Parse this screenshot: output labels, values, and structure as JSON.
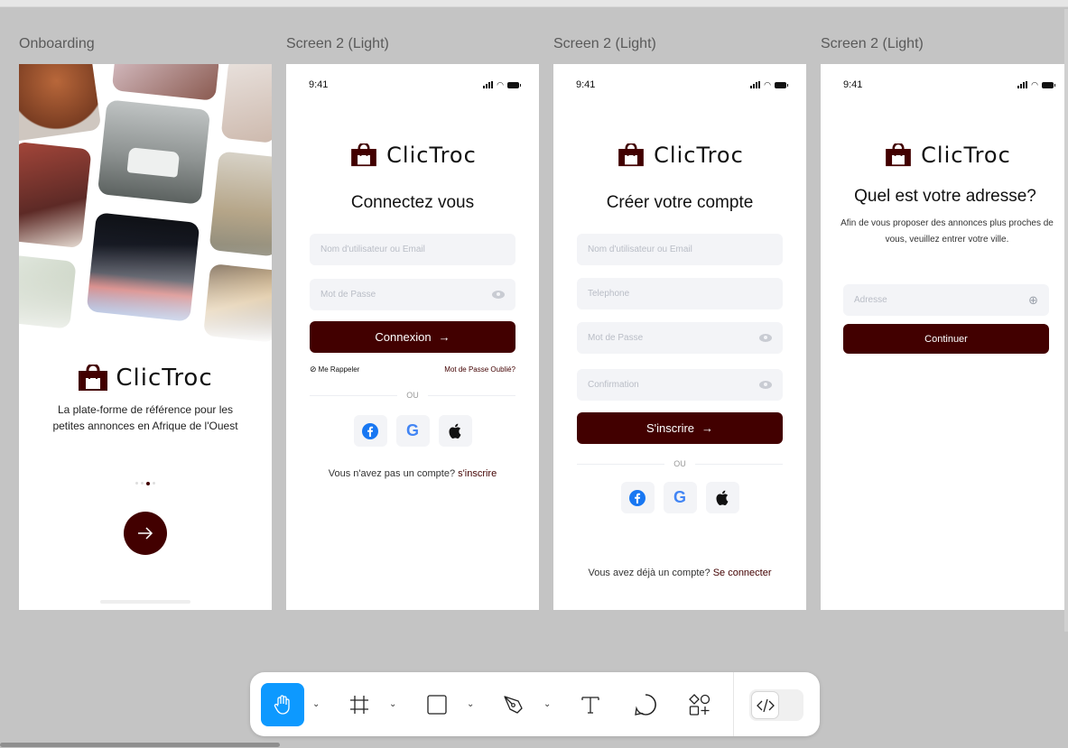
{
  "canvas": {
    "frames": [
      {
        "label": "Onboarding"
      },
      {
        "label": "Screen 2 (Light)"
      },
      {
        "label": "Screen 2 (Light)"
      },
      {
        "label": "Screen 2 (Light)"
      }
    ]
  },
  "status_time": "9:41",
  "brand_name": "ClicTroc",
  "onboarding": {
    "tagline": "La plate-forme de référence pour les petites annonces en Afrique de l'Ouest",
    "next_icon": "arrow-right-icon"
  },
  "login": {
    "title": "Connectez vous",
    "username_placeholder": "Nom d'utilisateur ou Email",
    "password_placeholder": "Mot de Passe",
    "submit_label": "Connexion",
    "remember_label": "Me Rappeler",
    "forgot_label": "Mot de Passe Oublié?",
    "or_label": "OU",
    "footer_text": "Vous n'avez pas un compte?",
    "footer_link": "s'inscrire"
  },
  "signup": {
    "title": "Créer votre compte",
    "username_placeholder": "Nom d'utilisateur ou Email",
    "phone_placeholder": "Telephone",
    "password_placeholder": "Mot de Passe",
    "confirm_placeholder": "Confirmation",
    "submit_label": "S'inscrire",
    "or_label": "OU",
    "footer_text": "Vous avez déjà un compte?",
    "footer_link": "Se connecter"
  },
  "address": {
    "title": "Quel est votre adresse?",
    "subtitle": "Afin de vous proposer des annonces plus proches de vous, veuillez entrer votre ville.",
    "address_placeholder": "Adresse",
    "submit_label": "Continuer"
  },
  "toolbar": {
    "tools": [
      {
        "icon": "hand-tool-icon",
        "active": true
      },
      {
        "icon": "frame-tool-icon"
      },
      {
        "icon": "rectangle-tool-icon"
      },
      {
        "icon": "pen-tool-icon"
      },
      {
        "icon": "text-tool-icon"
      },
      {
        "icon": "comment-tool-icon"
      },
      {
        "icon": "assets-tool-icon"
      }
    ],
    "dev_mode_icon": "code-icon"
  },
  "colors": {
    "brand": "#420000",
    "selection": "#0d99ff",
    "canvas": "#c4c4c4"
  }
}
